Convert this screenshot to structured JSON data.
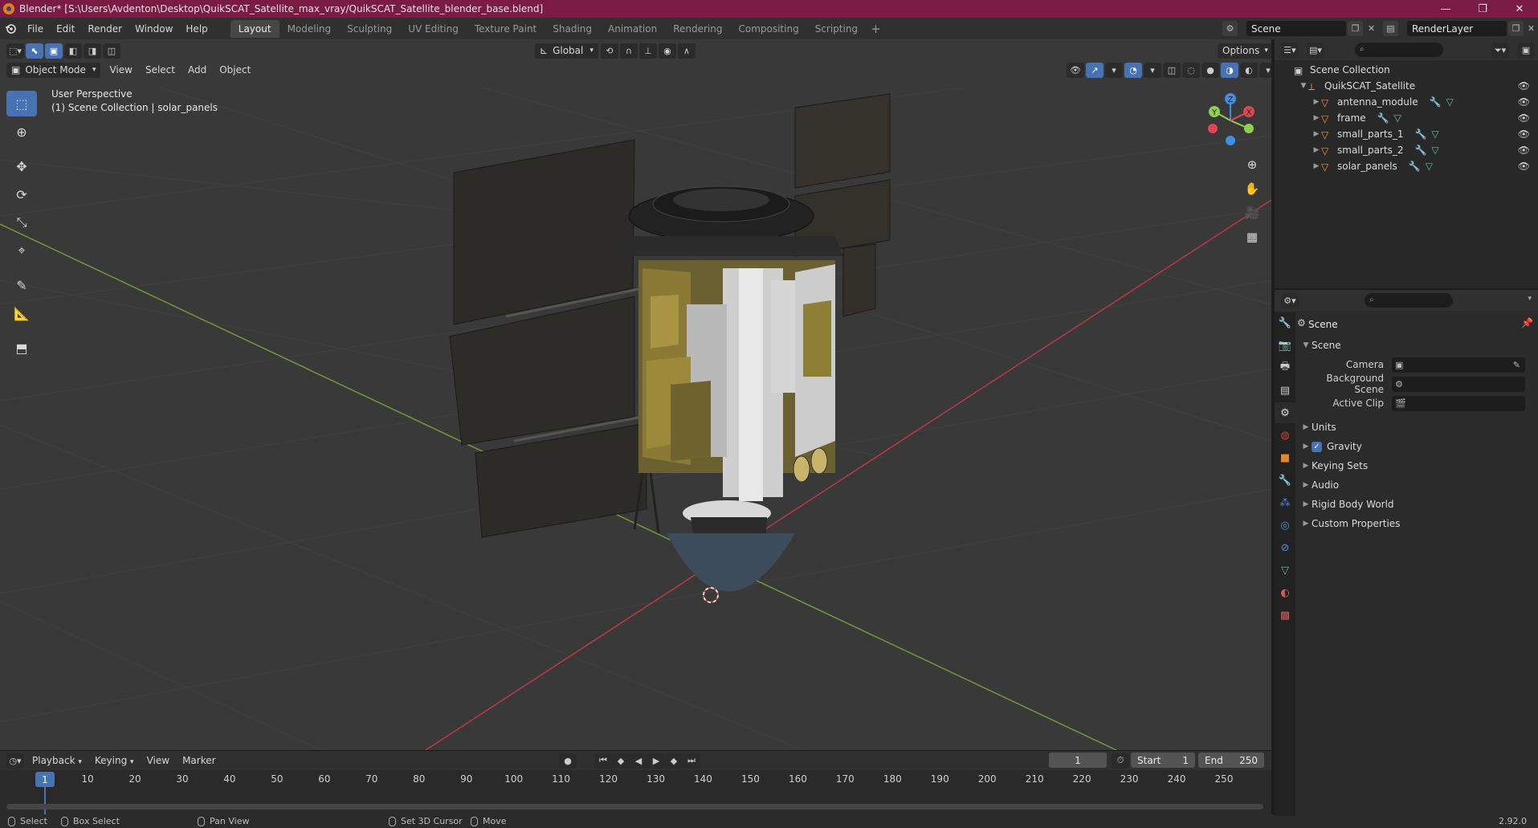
{
  "titlebar": {
    "title": "Blender* [S:\\Users\\Avdenton\\Desktop\\QuikSCAT_Satellite_max_vray/QuikSCAT_Satellite_blender_base.blend]",
    "minimize": "—",
    "restore": "❐",
    "close": "✕"
  },
  "menu": [
    "File",
    "Edit",
    "Render",
    "Window",
    "Help"
  ],
  "workspaces": [
    "Layout",
    "Modeling",
    "Sculpting",
    "UV Editing",
    "Texture Paint",
    "Shading",
    "Animation",
    "Rendering",
    "Compositing",
    "Scripting"
  ],
  "active_workspace": "Layout",
  "scene_name": "Scene",
  "render_layer": "RenderLayer",
  "viewport": {
    "mode": "Object Mode",
    "menus": [
      "View",
      "Select",
      "Add",
      "Object"
    ],
    "orientation": "Global",
    "options_label": "Options",
    "perspective_label": "User Perspective",
    "collection_label": "(1) Scene Collection | solar_panels",
    "gizmo": {
      "x": "X",
      "y": "Y",
      "z": "Z"
    }
  },
  "timeline": {
    "menus": [
      "Playback",
      "Keying",
      "View",
      "Marker"
    ],
    "current_frame": "1",
    "start_label": "Start",
    "start_value": "1",
    "end_label": "End",
    "end_value": "250",
    "ruler": [
      "10",
      "20",
      "30",
      "40",
      "50",
      "60",
      "70",
      "80",
      "90",
      "100",
      "110",
      "120",
      "130",
      "140",
      "150",
      "160",
      "170",
      "180",
      "190",
      "200",
      "210",
      "220",
      "230",
      "240",
      "250"
    ]
  },
  "statusbar": {
    "select": "Select",
    "box_select": "Box Select",
    "pan_view": "Pan View",
    "set_cursor": "Set 3D Cursor",
    "move": "Move",
    "version": "2.92.0"
  },
  "outliner": {
    "root": "Scene Collection",
    "collection": "QuikSCAT_Satellite",
    "objects": [
      "antenna_module",
      "frame",
      "small_parts_1",
      "small_parts_2",
      "solar_panels"
    ]
  },
  "properties": {
    "title": "Scene",
    "panel": "Scene",
    "camera_label": "Camera",
    "background_scene_label": "Background Scene",
    "active_clip_label": "Active Clip",
    "sections": [
      "Units",
      "Gravity",
      "Keying Sets",
      "Audio",
      "Rigid Body World",
      "Custom Properties"
    ]
  },
  "colors": {
    "accent": "#4772b3",
    "titlebar": "#7a1b43",
    "x_axis": "#e0464f",
    "y_axis": "#8fd14f",
    "z_axis": "#3f8fe8"
  }
}
